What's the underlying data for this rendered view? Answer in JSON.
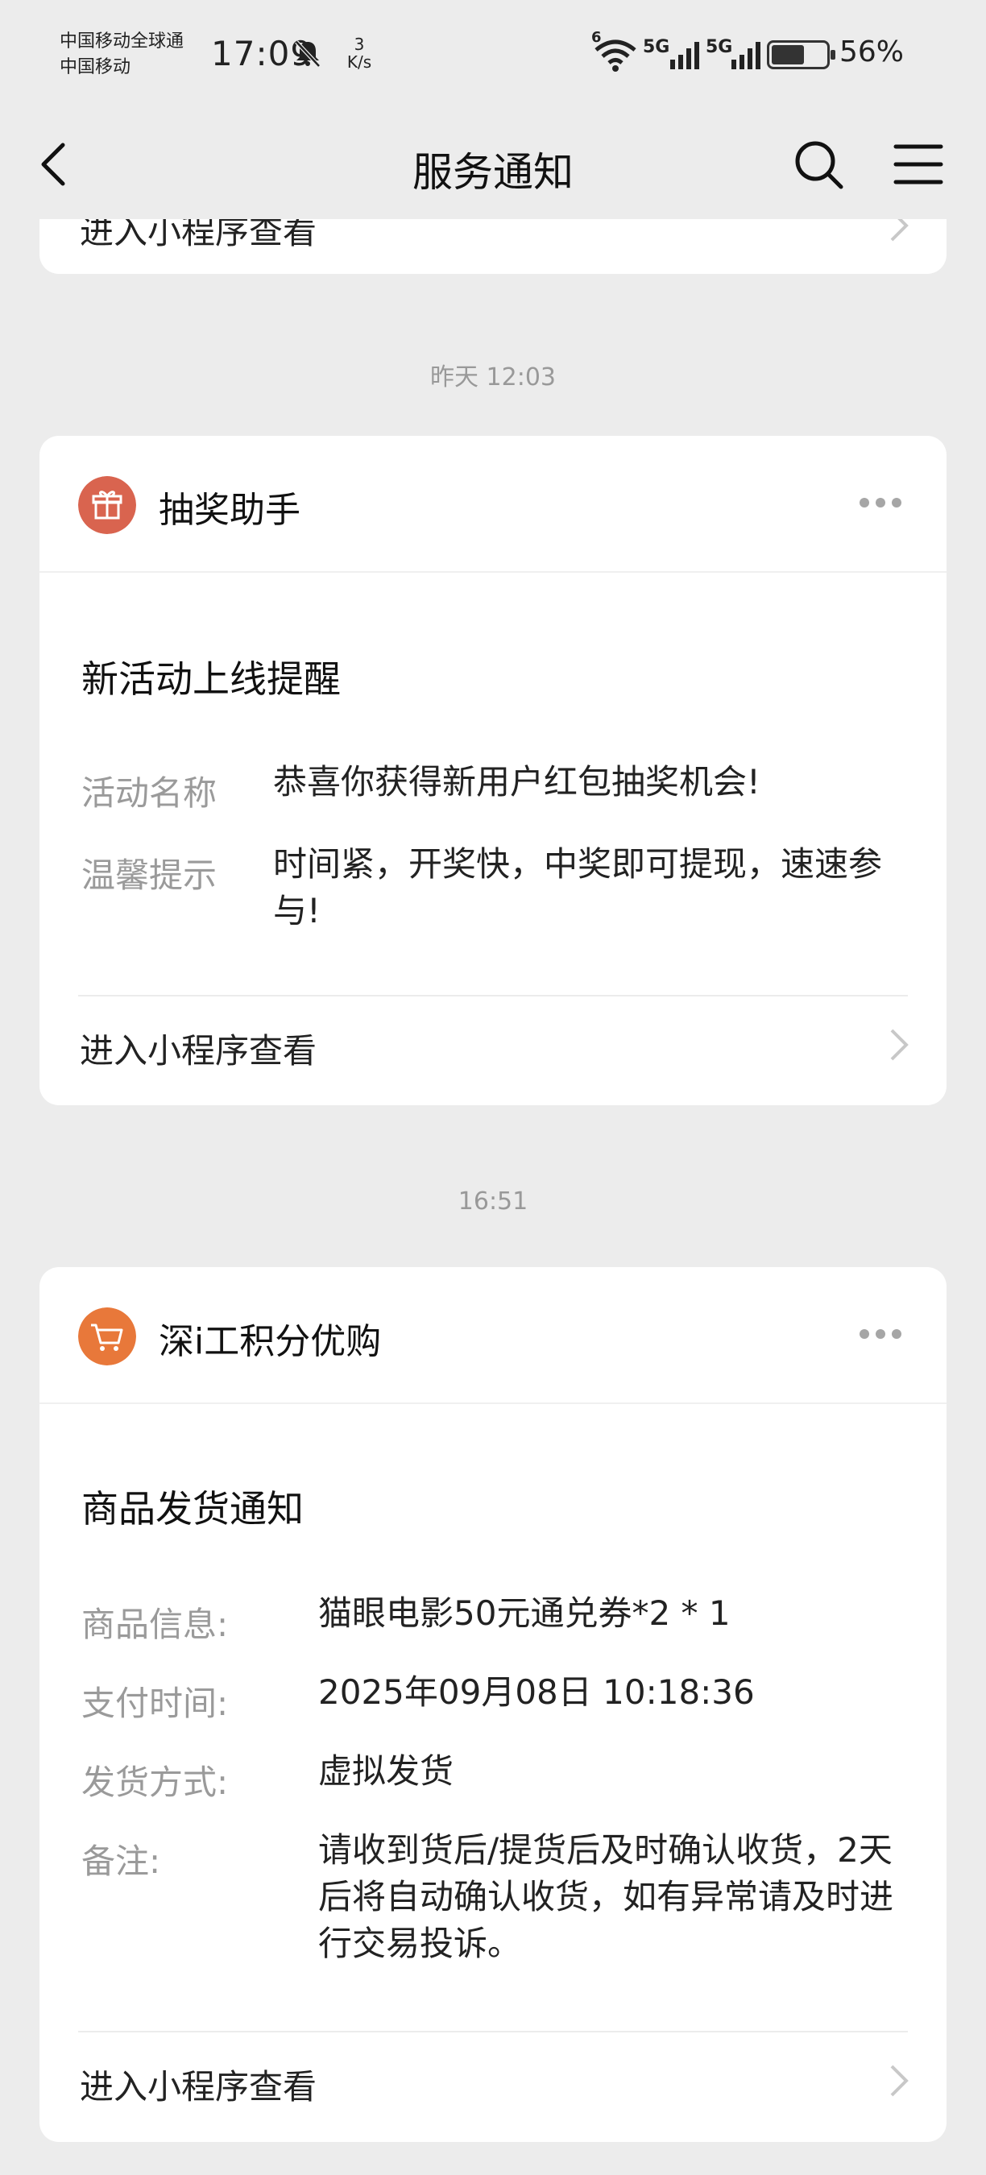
{
  "status_bar": {
    "carrier_line1": "中国移动全球通",
    "carrier_line2": "中国移动",
    "time": "17:09",
    "net_speed_value": "3",
    "net_speed_unit": "K/s",
    "wifi_label": "6",
    "sim1_label": "5G",
    "sim2_label": "5G",
    "battery_percent": "56%"
  },
  "navbar": {
    "title": "服务通知"
  },
  "top_card": {
    "open_label": "进入小程序查看"
  },
  "messages": [
    {
      "timestamp": "昨天 12:03",
      "app_name": "抽奖助手",
      "icon_color": "#d9644f",
      "title": "新活动上线提醒",
      "fields": [
        {
          "label": "活动名称",
          "value": "恭喜你获得新用户红包抽奖机会!"
        },
        {
          "label": "温馨提示",
          "value": "时间紧，开奖快，中奖即可提现，速速参与!"
        }
      ],
      "open_label": "进入小程序查看"
    },
    {
      "timestamp": "16:51",
      "app_name": "深i工积分优购",
      "icon_color": "#e8783a",
      "title": "商品发货通知",
      "fields": [
        {
          "label": "商品信息:",
          "value": "猫眼电影50元通兑券*2 * 1"
        },
        {
          "label": "支付时间:",
          "value": "2025年09月08日 10:18:36"
        },
        {
          "label": "发货方式:",
          "value": "虚拟发货"
        },
        {
          "label": "备注:",
          "value": "请收到货后/提货后及时确认收货，2天后将自动确认收货，如有异常请及时进行交易投诉。"
        }
      ],
      "open_label": "进入小程序查看"
    }
  ]
}
